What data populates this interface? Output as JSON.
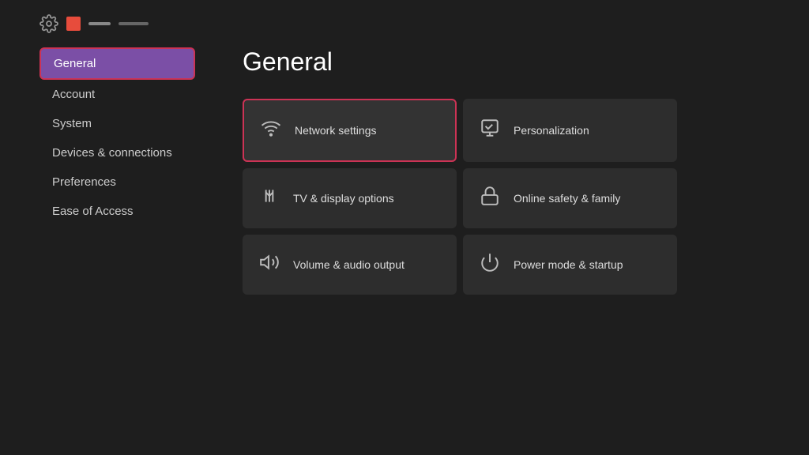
{
  "header": {
    "title": "General"
  },
  "sidebar": {
    "items": [
      {
        "id": "general",
        "label": "General",
        "active": true
      },
      {
        "id": "account",
        "label": "Account",
        "active": false
      },
      {
        "id": "system",
        "label": "System",
        "active": false
      },
      {
        "id": "devices",
        "label": "Devices & connections",
        "active": false
      },
      {
        "id": "preferences",
        "label": "Preferences",
        "active": false
      },
      {
        "id": "ease",
        "label": "Ease of Access",
        "active": false
      }
    ]
  },
  "grid": {
    "items": [
      {
        "id": "network",
        "label": "Network settings",
        "focused": true
      },
      {
        "id": "personalization",
        "label": "Personalization",
        "focused": false
      },
      {
        "id": "tv-display",
        "label": "TV & display options",
        "focused": false
      },
      {
        "id": "online-safety",
        "label": "Online safety & family",
        "focused": false
      },
      {
        "id": "volume",
        "label": "Volume & audio output",
        "focused": false
      },
      {
        "id": "power",
        "label": "Power mode & startup",
        "focused": false
      }
    ]
  }
}
